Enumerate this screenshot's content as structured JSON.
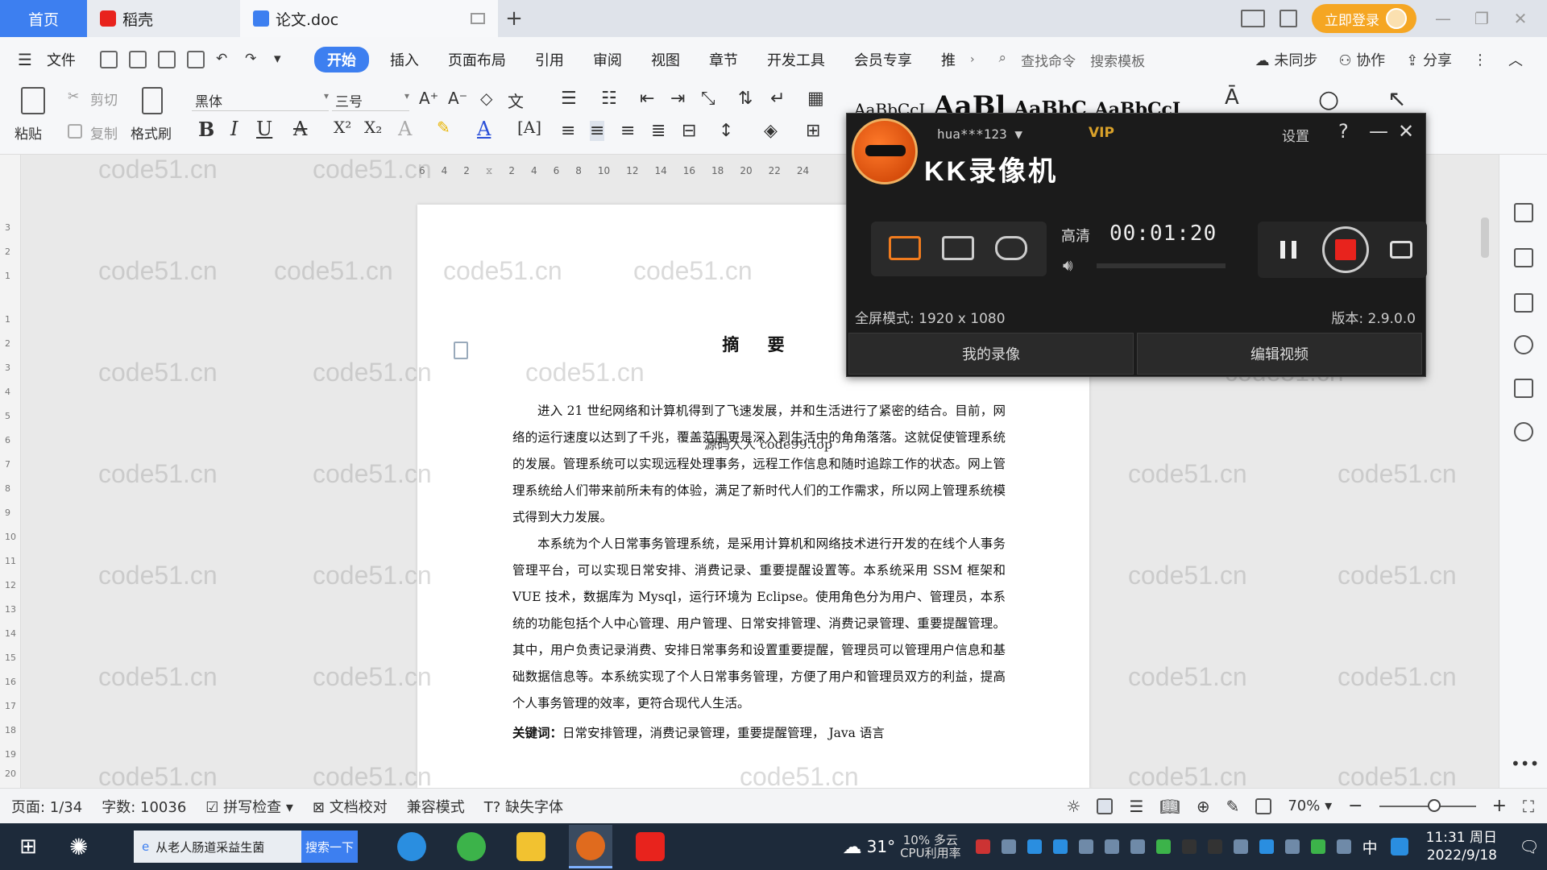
{
  "tabs": {
    "home": "首页",
    "daoke": "稻壳",
    "doc": "论文.doc",
    "add": "+"
  },
  "titlebar": {
    "login": "立即登录"
  },
  "menu": {
    "file": "文件",
    "items": [
      "开始",
      "插入",
      "页面布局",
      "引用",
      "审阅",
      "视图",
      "章节",
      "开发工具",
      "会员专享",
      "推"
    ],
    "search_cmd": "查找命令",
    "search_tpl": "搜索模板",
    "sync": "未同步",
    "collab": "协作",
    "share": "分享"
  },
  "ribbon": {
    "paste": "粘贴",
    "cut": "剪切",
    "copy": "复制",
    "format_painter": "格式刷",
    "font_name": "黑体",
    "font_size": "三号",
    "bold": "B",
    "italic": "I",
    "underline": "U",
    "styles": [
      "AaBbCcI",
      "AaBl",
      "AaBbC",
      "AaBbCcI"
    ]
  },
  "ruler": {
    "top_ticks": [
      "6",
      "4",
      "2",
      "2",
      "4",
      "6",
      "8",
      "10",
      "12",
      "14",
      "16",
      "18",
      "20",
      "22",
      "24"
    ],
    "left_ticks": [
      "3",
      "2",
      "1",
      "1",
      "2",
      "3",
      "4",
      "5",
      "6",
      "7",
      "8",
      "9",
      "10",
      "11",
      "12",
      "13",
      "14",
      "15",
      "16",
      "17",
      "18",
      "19",
      "20"
    ]
  },
  "document": {
    "title": "摘  要",
    "overlay": "源码人人 code99.top",
    "paragraphs": [
      "进入 21 世纪网络和计算机得到了飞速发展，并和生活进行了紧密的结合。目前，网络的运行速度以达到了千兆，覆盖范围更是深入到生活中的角角落落。这就促使管理系统的发展。管理系统可以实现远程处理事务，远程工作信息和随时追踪工作的状态。网上管理系统给人们带来前所未有的体验，满足了新时代人们的工作需求，所以网上管理系统模式得到大力发展。",
      "本系统为个人日常事务管理系统，是采用计算机和网络技术进行开发的在线个人事务管理平台，可以实现日常安排、消费记录、重要提醒设置等。本系统采用 SSM 框架和 VUE 技术，数据库为 Mysql，运行环境为 Eclipse。使用角色分为用户、管理员，本系统的功能包括个人中心管理、用户管理、日常安排管理、消费记录管理、重要提醒管理。其中，用户负责记录消费、安排日常事务和设置重要提醒，管理员可以管理用户信息和基础数据信息等。本系统实现了个人日常事务管理，方便了用户和管理员双方的利益，提高个人事务管理的效率，更符合现代人生活。"
    ],
    "keywords_label": "关键词：",
    "keywords": "日常安排管理，消费记录管理，重要提醒管理，  Java 语言"
  },
  "watermark": "code51.cn",
  "recorder": {
    "title": "KK录像机",
    "user": "hua***123",
    "vip": "VIP",
    "settings": "设置",
    "help": "?",
    "quality": "高清",
    "time": "00:01:20",
    "mode_line": "全屏模式: 1920 x 1080",
    "version": "版本: 2.9.0.0",
    "my_videos": "我的录像",
    "edit_video": "编辑视频"
  },
  "status": {
    "page": "页面: 1/34",
    "words": "字数: 10036",
    "spell": "拼写检查",
    "proof": "文档校对",
    "compat": "兼容模式",
    "missing_font": "缺失字体",
    "zoom": "70%"
  },
  "taskbar": {
    "search_text": "从老人肠道采益生菌",
    "search_btn": "搜索一下",
    "weather": "31°",
    "cpu_pct": "10%",
    "weather_desc": "多云",
    "cpu_label": "CPU利用率",
    "ime": "中",
    "time": "11:31 周日",
    "date": "2022/9/18"
  },
  "colors": {
    "accent": "#3d7ff0",
    "login": "#f5a623",
    "record_red": "#e8231d",
    "vip_gold": "#d9a12a"
  }
}
